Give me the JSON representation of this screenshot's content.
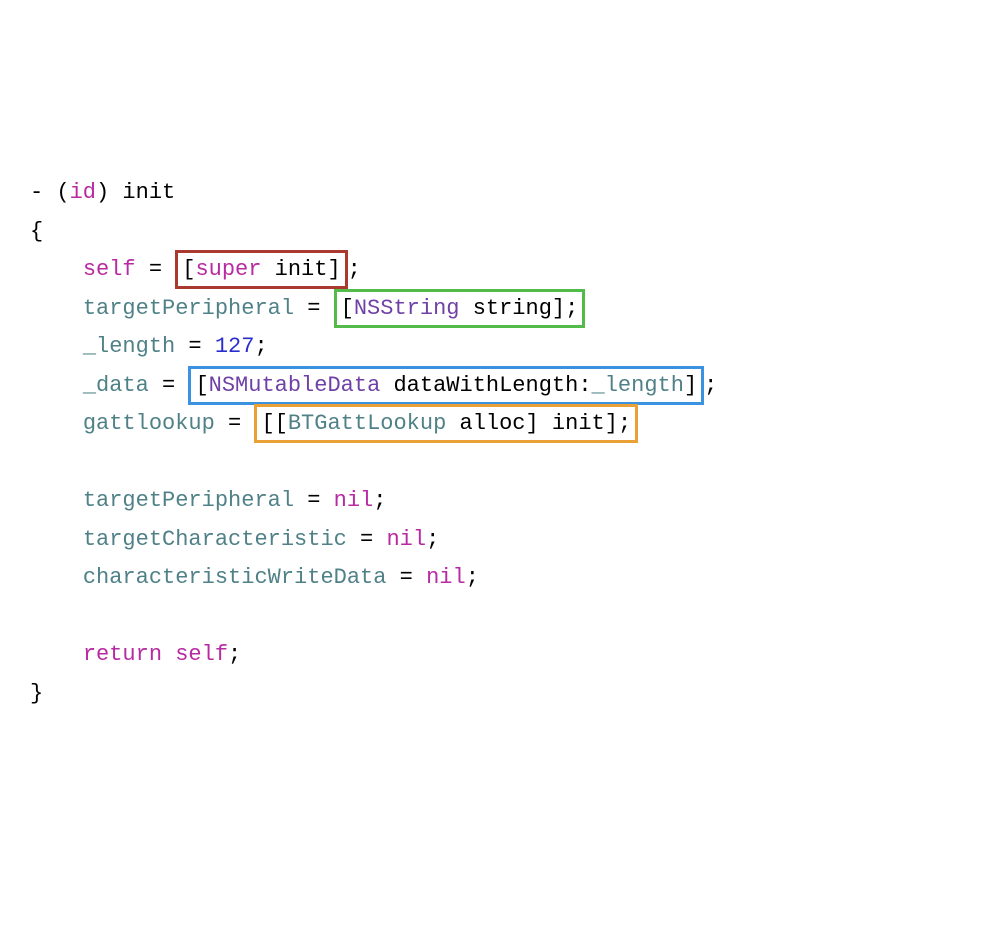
{
  "code": {
    "l1": {
      "dash": "-",
      "openp": "(",
      "id": "id",
      "closep": ")",
      "method": "init"
    },
    "l2": {
      "brace": "{"
    },
    "l3": {
      "self": "self",
      "eq": " = ",
      "box": {
        "open": "[",
        "super": "super",
        "sp": " ",
        "init": "init",
        "close": "]"
      },
      "semi": ";"
    },
    "l4": {
      "var": "targetPeripheral",
      "eq": " = ",
      "box": {
        "open": "[",
        "cls": "NSString",
        "sp": " ",
        "msg": "string",
        "close": "]",
        "semi": ";"
      }
    },
    "l5": {
      "var": "_length",
      "eq": " = ",
      "num": "127",
      "semi": ";"
    },
    "l6": {
      "var": "_data",
      "eq": " = ",
      "box": {
        "open": "[",
        "cls": "NSMutableData",
        "sp": " ",
        "msg": "dataWithLength:",
        "arg": "_length",
        "close": "]"
      },
      "semi": ";"
    },
    "l7": {
      "var": "gattlookup",
      "eq": " = ",
      "box": {
        "open1": "[",
        "open2": "[",
        "cls": "BTGattLookup",
        "sp": " ",
        "alloc": "alloc",
        "close1": "]",
        "sp2": " ",
        "init": "init",
        "close2": "]",
        "semi": ";"
      }
    },
    "l9": {
      "var": "targetPeripheral",
      "eq": " = ",
      "nil": "nil",
      "semi": ";"
    },
    "l10": {
      "var": "targetCharacteristic",
      "eq": " = ",
      "nil": "nil",
      "semi": ";"
    },
    "l11": {
      "var": "characteristicWriteData",
      "eq": " = ",
      "nil": "nil",
      "semi": ";"
    },
    "l13": {
      "return": "return",
      "sp": " ",
      "self": "self",
      "semi": ";"
    },
    "l14": {
      "brace": "}"
    }
  }
}
